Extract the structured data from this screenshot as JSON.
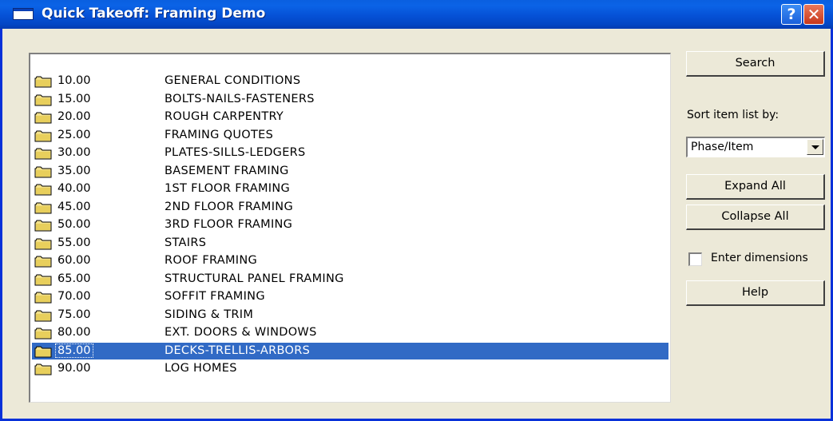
{
  "window": {
    "title": "Quick Takeoff:  Framing Demo",
    "help_symbol": "?",
    "close_symbol": "✕",
    "title_bar_color": "#0551d6"
  },
  "list": {
    "selection_color": "#316ac5",
    "folder_icon": "folder-icon",
    "items": [
      {
        "code": "10.00",
        "desc": "GENERAL CONDITIONS"
      },
      {
        "code": "15.00",
        "desc": "BOLTS-NAILS-FASTENERS"
      },
      {
        "code": "20.00",
        "desc": "ROUGH CARPENTRY"
      },
      {
        "code": "25.00",
        "desc": "FRAMING QUOTES"
      },
      {
        "code": "30.00",
        "desc": "PLATES-SILLS-LEDGERS"
      },
      {
        "code": "35.00",
        "desc": "BASEMENT FRAMING"
      },
      {
        "code": "40.00",
        "desc": "1ST FLOOR FRAMING"
      },
      {
        "code": "45.00",
        "desc": "2ND FLOOR FRAMING"
      },
      {
        "code": "50.00",
        "desc": "3RD FLOOR FRAMING"
      },
      {
        "code": "55.00",
        "desc": "STAIRS"
      },
      {
        "code": "60.00",
        "desc": "ROOF FRAMING"
      },
      {
        "code": "65.00",
        "desc": "STRUCTURAL PANEL FRAMING"
      },
      {
        "code": "70.00",
        "desc": "SOFFIT FRAMING"
      },
      {
        "code": "75.00",
        "desc": "SIDING & TRIM"
      },
      {
        "code": "80.00",
        "desc": "EXT. DOORS & WINDOWS"
      },
      {
        "code": "85.00",
        "desc": "DECKS-TRELLIS-ARBORS"
      },
      {
        "code": "90.00",
        "desc": "LOG HOMES"
      }
    ]
  },
  "side": {
    "search_label": "Search",
    "sort_label": "Sort item list by:",
    "sort_value": "Phase/Item",
    "expand_label": "Expand All",
    "collapse_label": "Collapse All",
    "enter_dimensions_label": "Enter dimensions",
    "enter_dimensions_checked": false,
    "help_label": "Help"
  }
}
